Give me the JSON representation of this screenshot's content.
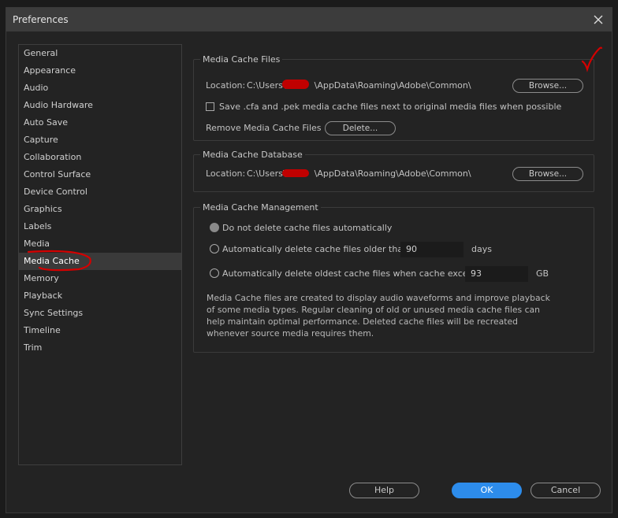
{
  "window": {
    "title": "Preferences"
  },
  "sidebar": {
    "selected_index": 12,
    "items": [
      {
        "label": "General"
      },
      {
        "label": "Appearance"
      },
      {
        "label": "Audio"
      },
      {
        "label": "Audio Hardware"
      },
      {
        "label": "Auto Save"
      },
      {
        "label": "Capture"
      },
      {
        "label": "Collaboration"
      },
      {
        "label": "Control Surface"
      },
      {
        "label": "Device Control"
      },
      {
        "label": "Graphics"
      },
      {
        "label": "Labels"
      },
      {
        "label": "Media"
      },
      {
        "label": "Media Cache"
      },
      {
        "label": "Memory"
      },
      {
        "label": "Playback"
      },
      {
        "label": "Sync Settings"
      },
      {
        "label": "Timeline"
      },
      {
        "label": "Trim"
      }
    ]
  },
  "cache_files": {
    "title": "Media Cache Files",
    "location_label": "Location:",
    "path_prefix": "C:\\Users\\",
    "path_suffix": "\\AppData\\Roaming\\Adobe\\Common\\",
    "browse_label": "Browse...",
    "save_checkbox_label": "Save .cfa and .pek media cache files next to original media files when possible",
    "save_checked": false,
    "remove_label": "Remove Media Cache Files",
    "delete_label": "Delete..."
  },
  "cache_db": {
    "title": "Media Cache Database",
    "location_label": "Location:",
    "path_prefix": "C:\\Users\\",
    "path_suffix": "\\AppData\\Roaming\\Adobe\\Common\\",
    "browse_label": "Browse..."
  },
  "cache_mgmt": {
    "title": "Media Cache Management",
    "option_none": "Do not delete cache files automatically",
    "option_older": "Automatically delete cache files older than:",
    "older_value": "90",
    "older_unit": "days",
    "option_exceeds": "Automatically delete oldest cache files when cache exceeds:",
    "exceeds_value": "93",
    "exceeds_unit": "GB",
    "selected_option": "none",
    "description": "Media Cache files are created to display audio waveforms and improve playback of some media types.  Regular cleaning of old or unused media cache files can help maintain optimal performance. Deleted cache files will be recreated whenever source media requires them."
  },
  "footer": {
    "help_label": "Help",
    "ok_label": "OK",
    "cancel_label": "Cancel"
  },
  "colors": {
    "accent": "#2d8ceb",
    "annotation_red": "#d40000"
  }
}
